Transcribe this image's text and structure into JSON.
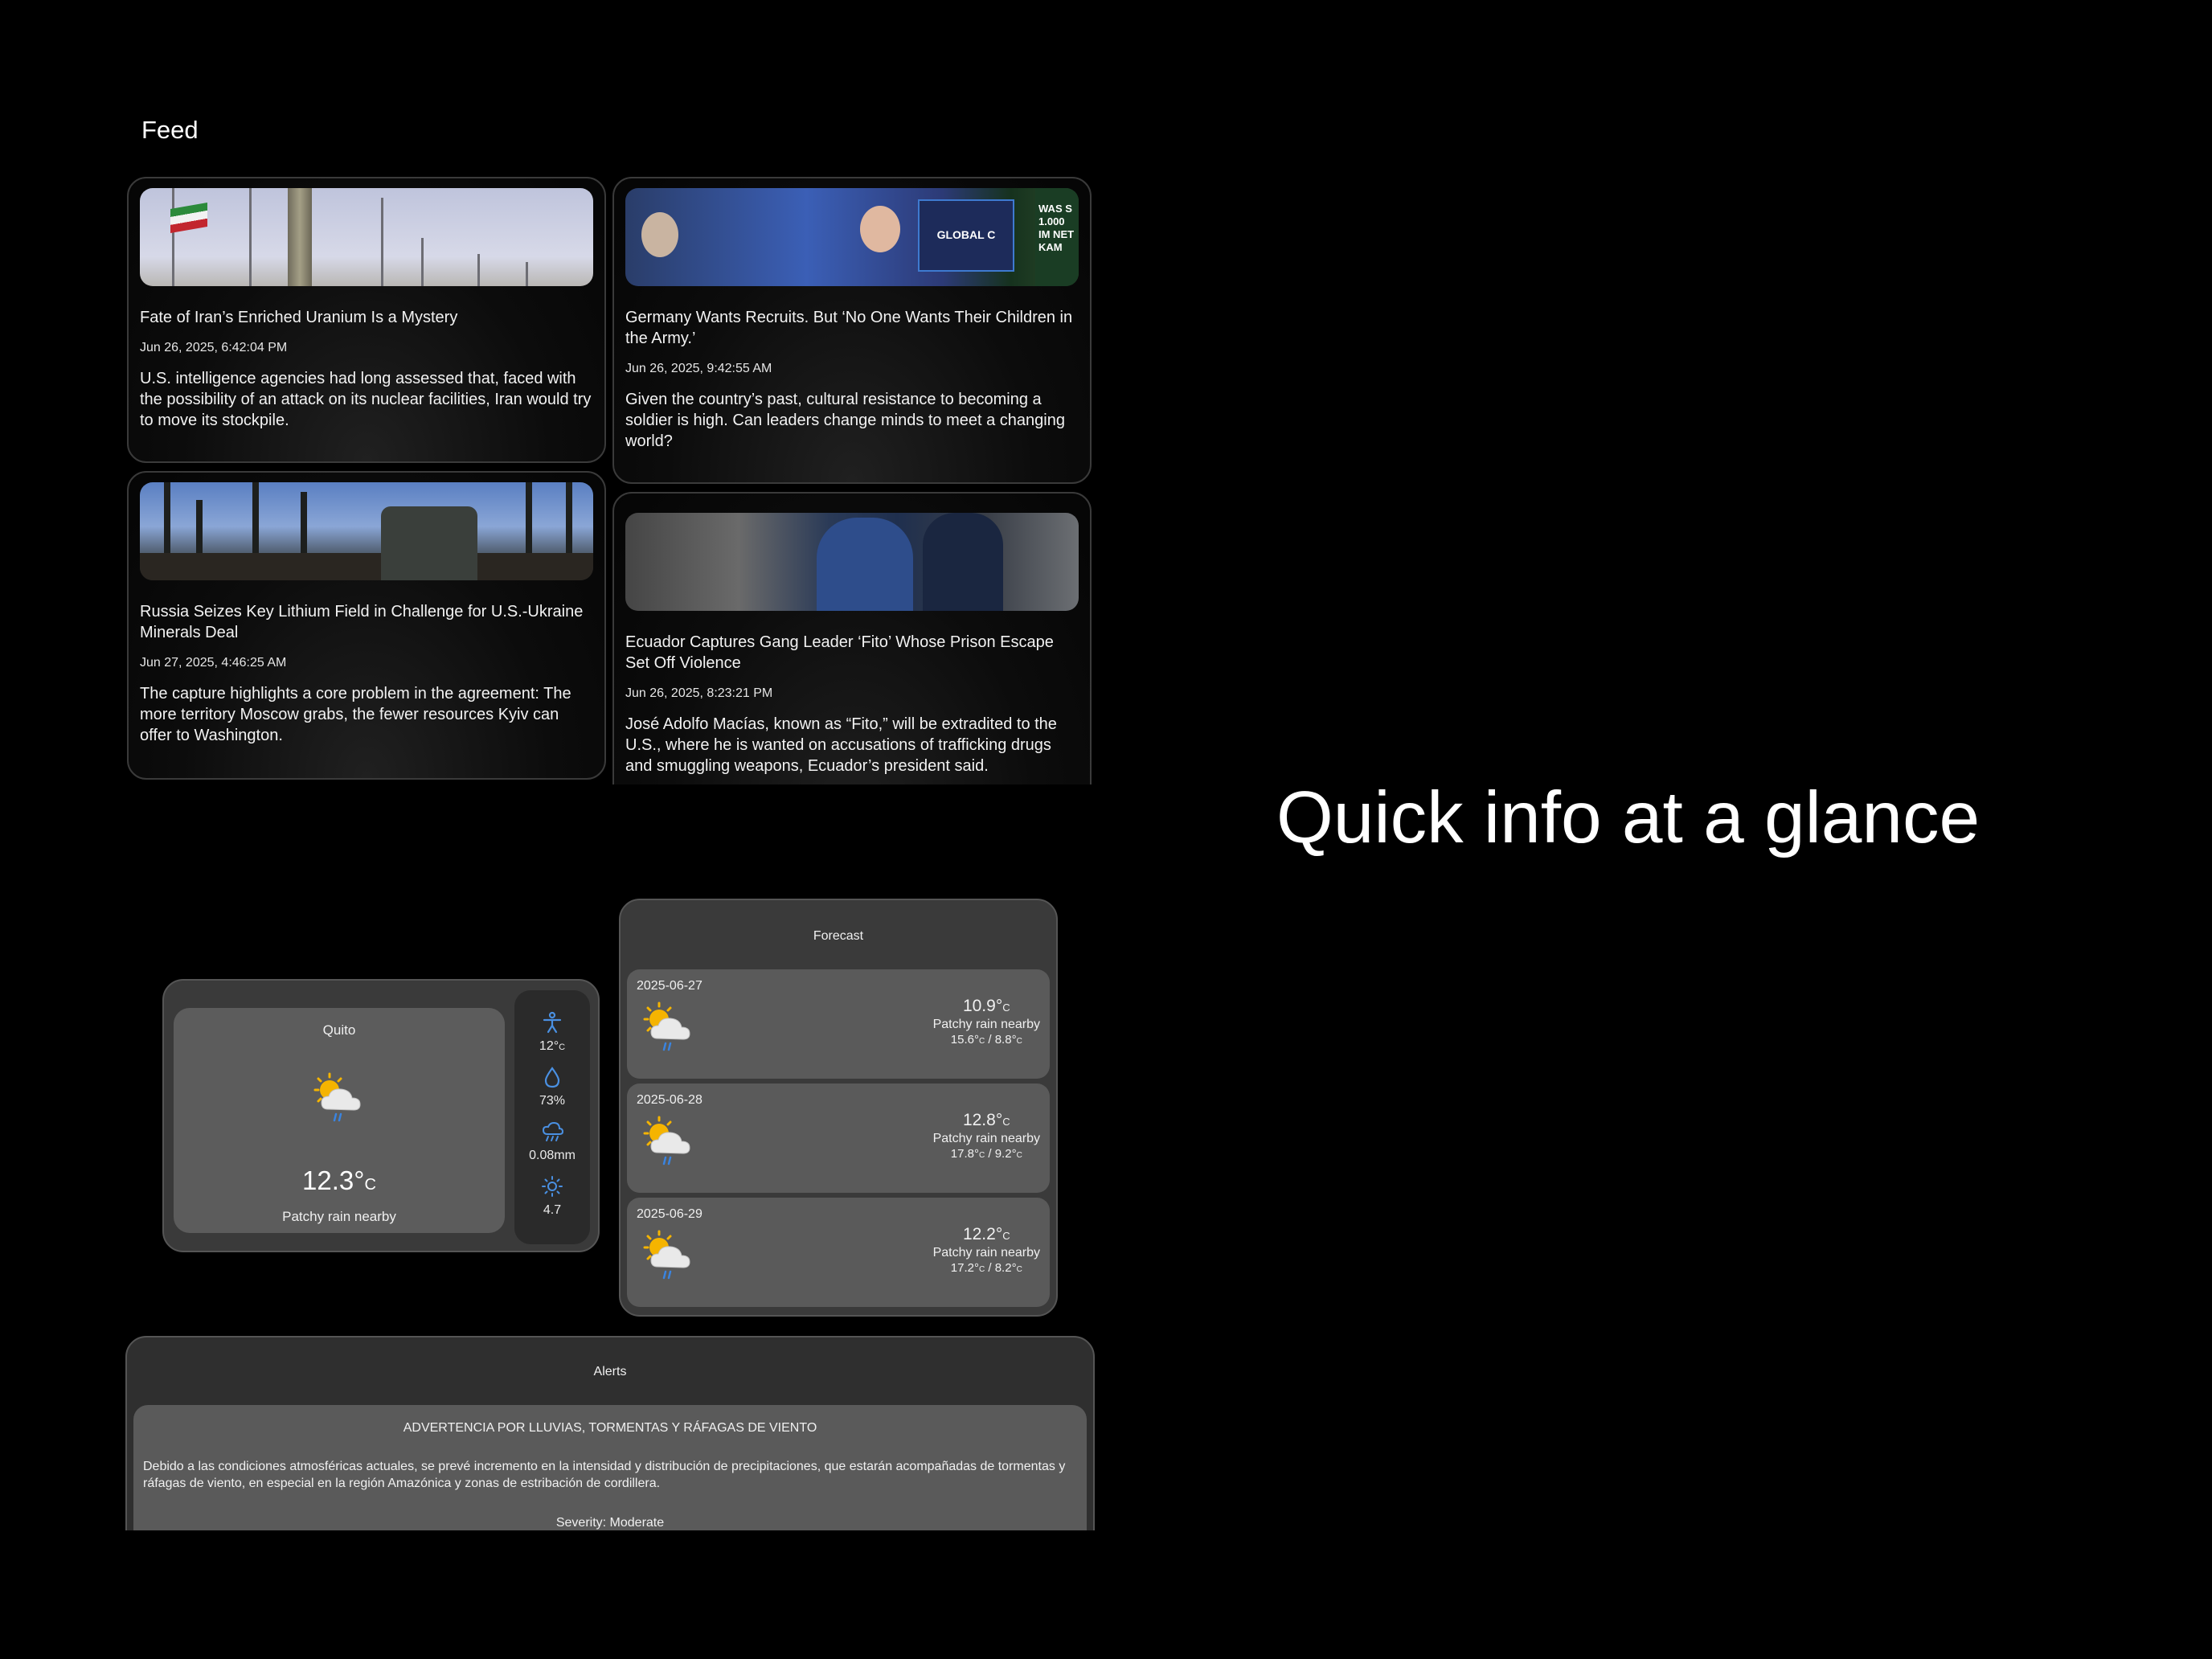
{
  "feed": {
    "title": "Feed",
    "articles": [
      {
        "headline": "Fate of Iran’s Enriched Uranium Is a Mystery",
        "date": "Jun 26, 2025, 6:42:04 PM",
        "summary": "U.S. intelligence agencies had long assessed that, faced with the possibility of an attack on its nuclear facilities, Iran would try to move its stockpile."
      },
      {
        "headline": "Germany Wants Recruits. But ‘No One Wants Their Children in the Army.’",
        "date": "Jun 26, 2025, 9:42:55 AM",
        "summary": "Given the country’s past, cultural resistance to becoming a soldier is high. Can leaders change minds to meet a changing world?",
        "image_text_booth": "GLOBAL C",
        "image_text_sign": "WAS S 1.000 IM NET KAM"
      },
      {
        "headline": "Russia Seizes Key Lithium Field in Challenge for U.S.-Ukraine Minerals Deal",
        "date": "Jun 27, 2025, 4:46:25 AM",
        "summary": "The capture highlights a core problem in the agreement: The more territory Moscow grabs, the fewer resources Kyiv can offer to Washington."
      },
      {
        "headline": "Ecuador Captures Gang Leader ‘Fito’ Whose Prison Escape Set Off Violence",
        "date": "Jun 26, 2025, 8:23:21 PM",
        "summary": "José Adolfo Macías, known as “Fito,” will be extradited to the U.S., where he is wanted on accusations of trafficking drugs and smuggling weapons, Ecuador’s president said."
      }
    ]
  },
  "weather": {
    "city": "Quito",
    "temp": "12.3°",
    "temp_unit": "C",
    "condition": "Patchy rain nearby",
    "icon": "partly-cloudy-rain-icon",
    "feels_like": "12°",
    "feels_like_unit": "C",
    "humidity": "73%",
    "precip": "0.08mm",
    "uv": "4.7"
  },
  "forecast": {
    "title": "Forecast",
    "days": [
      {
        "date": "2025-06-27",
        "temp": "10.9°",
        "unit": "C",
        "condition": "Patchy rain nearby",
        "high": "15.6°",
        "low": "8.8°"
      },
      {
        "date": "2025-06-28",
        "temp": "12.8°",
        "unit": "C",
        "condition": "Patchy rain nearby",
        "high": "17.8°",
        "low": "9.2°"
      },
      {
        "date": "2025-06-29",
        "temp": "12.2°",
        "unit": "C",
        "condition": "Patchy rain nearby",
        "high": "17.2°",
        "low": "8.2°"
      }
    ]
  },
  "alerts": {
    "title": "Alerts",
    "items": [
      {
        "headline": "ADVERTENCIA POR LLUVIAS, TORMENTAS Y RÁFAGAS DE VIENTO",
        "description": "Debido a las condiciones atmosféricas actuales, se prevé incremento en la intensidad y distribución de precipitaciones, que estarán acompañadas de tormentas y ráfagas de viento, en especial en la región Amazónica y zonas de estribación de cordillera.",
        "severity": "Severity: Moderate"
      }
    ]
  },
  "tagline": "Quick info at a glance",
  "colors": {
    "background": "#000000",
    "card": "#3a3a3a",
    "panel": "#5a5a5a",
    "accent_blue": "#4a90e2",
    "sun": "#f5b400"
  }
}
